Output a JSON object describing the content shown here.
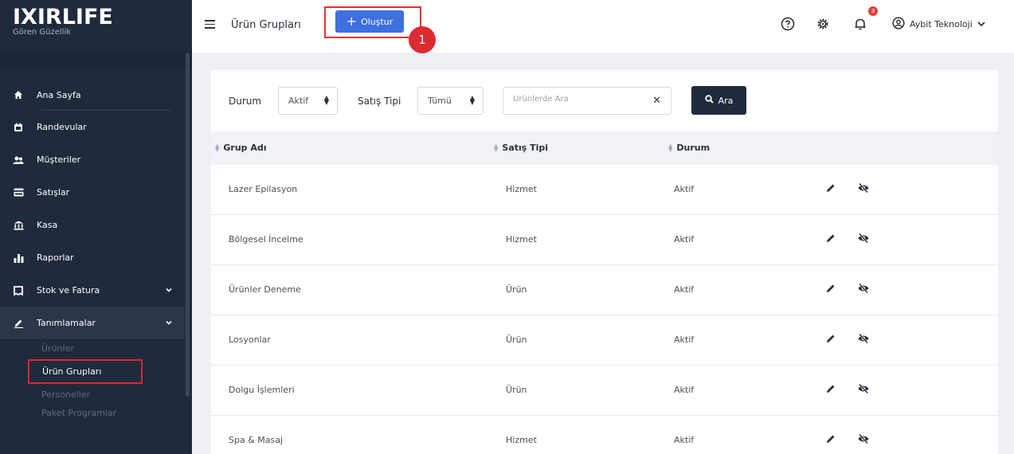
{
  "brand": {
    "title": "IXIRLIFE",
    "subtitle": "Gören Güzellik"
  },
  "sidebar": {
    "items": [
      {
        "label": "Ana Sayfa",
        "icon": "home-icon"
      },
      {
        "label": "Randevular",
        "icon": "calendar-icon"
      },
      {
        "label": "Müşteriler",
        "icon": "users-icon"
      },
      {
        "label": "Satışlar",
        "icon": "card-icon"
      },
      {
        "label": "Kasa",
        "icon": "bank-icon"
      },
      {
        "label": "Raporlar",
        "icon": "chart-icon"
      },
      {
        "label": "Stok ve Fatura",
        "icon": "invoice-icon"
      },
      {
        "label": "Tanımlamalar",
        "icon": "pencil-icon"
      }
    ],
    "sub_items": [
      "Ürünler",
      "Ürün Grupları",
      "Personeller",
      "Paket Programlar"
    ]
  },
  "header": {
    "title": "Ürün Grupları",
    "create_label": "Oluştur",
    "step_number": "1",
    "notif_count": "3",
    "user_name": "Aybit Teknoloji"
  },
  "filters": {
    "status_label": "Durum",
    "status_value": "Aktif",
    "sales_type_label": "Satış Tipi",
    "sales_type_value": "Tümü",
    "search_placeholder": "Ürünlerde Ara",
    "search_button": "Ara"
  },
  "table": {
    "headers": [
      "Grup Adı",
      "Satış Tipi",
      "Durum"
    ],
    "rows": [
      [
        "Lazer Epilasyon",
        "Hizmet",
        "Aktif"
      ],
      [
        "Bölgesel İncelme",
        "Hizmet",
        "Aktif"
      ],
      [
        "Ürünler Deneme",
        "Ürün",
        "Aktif"
      ],
      [
        "Losyonlar",
        "Ürün",
        "Aktif"
      ],
      [
        "Dolgu İşlemleri",
        "Ürün",
        "Aktif"
      ],
      [
        "Spa & Masaj",
        "Hizmet",
        "Aktif"
      ]
    ]
  },
  "colors": {
    "sidebar_bg": "#1f2a3d",
    "primary": "#3e6fde",
    "highlight": "#e03238"
  }
}
